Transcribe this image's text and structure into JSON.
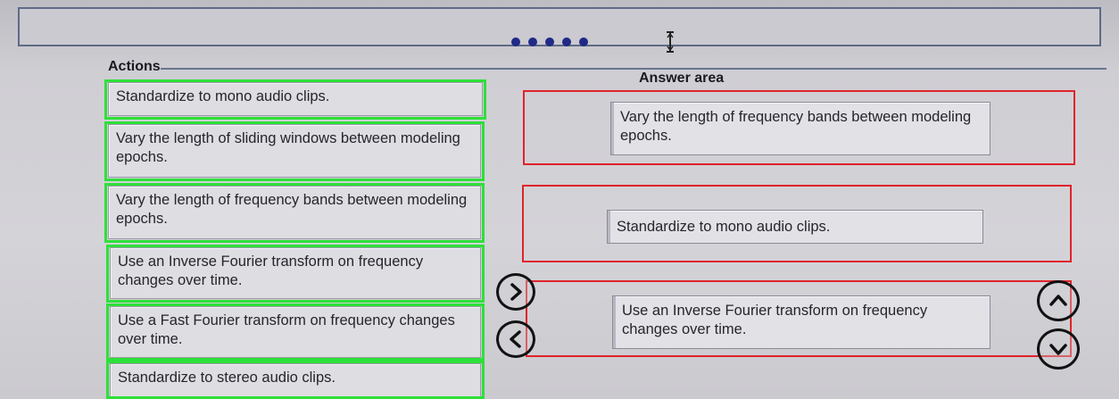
{
  "actions": {
    "title": "Actions",
    "items": [
      {
        "label": "Standardize to mono audio clips."
      },
      {
        "label": "Vary the length of sliding windows between modeling epochs."
      },
      {
        "label": "Vary the length of frequency bands between modeling epochs."
      },
      {
        "label": "Use an Inverse Fourier transform on frequency changes over time."
      },
      {
        "label": "Use a Fast Fourier transform on frequency changes over time."
      },
      {
        "label": "Standardize to stereo audio clips."
      }
    ]
  },
  "answer_area": {
    "title": "Answer area",
    "slots": [
      {
        "label": "Vary the length of frequency bands between modeling epochs."
      },
      {
        "label": "Standardize to mono audio clips."
      },
      {
        "label": "Use an Inverse Fourier transform on frequency changes over time."
      }
    ]
  },
  "controls": {
    "move_right_icon": "chevron-right-icon",
    "move_left_icon": "chevron-left-icon",
    "move_up_icon": "chevron-up-icon",
    "move_down_icon": "chevron-down-icon"
  },
  "progress": {
    "dot_count": 5
  },
  "colors": {
    "selection_green": "#2ee03a",
    "answer_red": "#e0232a",
    "dot_blue": "#1e2a86"
  }
}
